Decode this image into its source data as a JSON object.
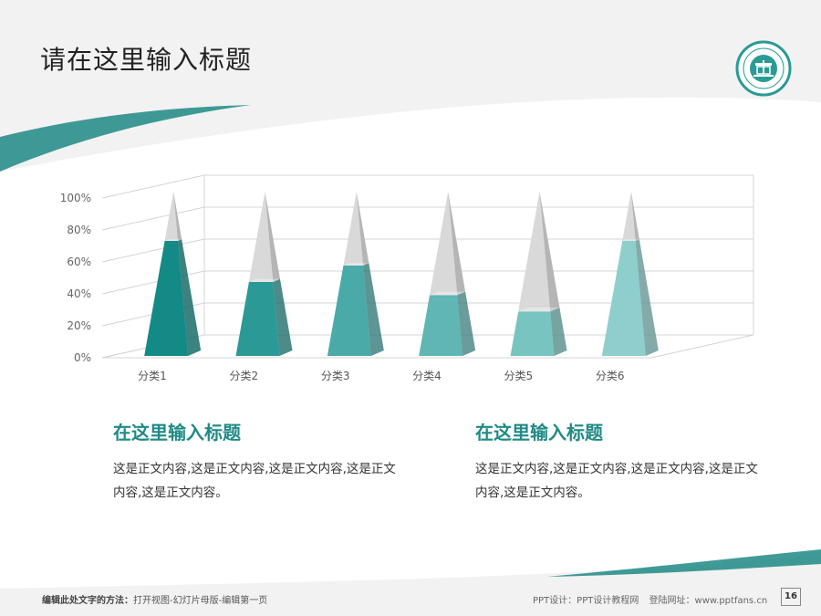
{
  "header": {
    "title": "请在这里输入标题"
  },
  "colors": {
    "accent": "#1f8a86",
    "band": "#f2f2f2"
  },
  "logo": {
    "icon": "school-emblem-icon"
  },
  "chart_data": {
    "type": "bar",
    "style": "3d-pyramid",
    "categories": [
      "分类1",
      "分类2",
      "分类3",
      "分类4",
      "分类5",
      "分类6"
    ],
    "values": [
      70,
      45,
      55,
      37,
      27,
      70
    ],
    "ylim": [
      0,
      100
    ],
    "yticks": [
      "0%",
      "20%",
      "40%",
      "60%",
      "80%",
      "100%"
    ],
    "grid": true,
    "colors": [
      "#138a85",
      "#2b9a96",
      "#4aaaa8",
      "#5fb6b3",
      "#77c4c1",
      "#8ecfcd"
    ]
  },
  "sections": [
    {
      "heading": "在这里输入标题",
      "body": "这是正文内容,这是正文内容,这是正文内容,这是正文内容,这是正文内容。"
    },
    {
      "heading": "在这里输入标题",
      "body": "这是正文内容,这是正文内容,这是正文内容,这是正文内容,这是正文内容。"
    }
  ],
  "footer": {
    "left_label": "编辑此处文字的方法：",
    "left_text": "打开视图-幻灯片母版-编辑第一页",
    "design": "PPT设计：PPT设计教程网",
    "site": "登陆网址：www.pptfans.cn",
    "page": "16"
  }
}
